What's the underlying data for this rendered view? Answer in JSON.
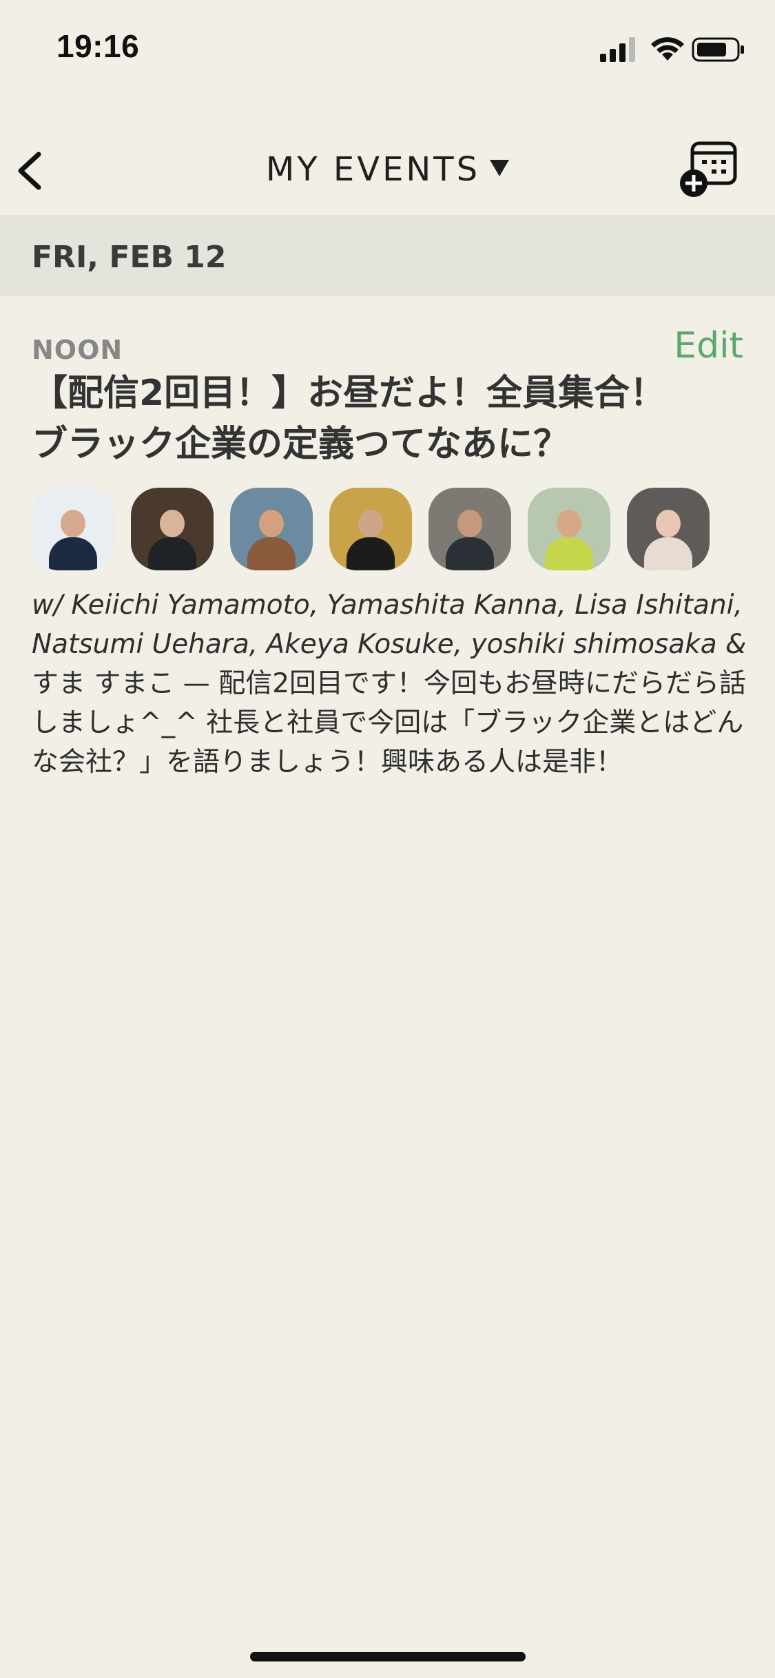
{
  "status_bar": {
    "time": "19:16",
    "icons": [
      "cellular-signal-icon",
      "wifi-icon",
      "battery-icon"
    ]
  },
  "nav": {
    "back_icon": "chevron-left-icon",
    "title": "MY EVENTS",
    "title_dropdown_icon": "caret-down-icon",
    "action_icon": "calendar-add-icon"
  },
  "date_header": {
    "label": "FRI, FEB 12"
  },
  "event": {
    "time": "NOON",
    "edit_label": "Edit",
    "title": "【配信2回目！】お昼だよ！全員集合！ブラック企業の定義つてなあに？",
    "hosts": "w/ Keiichi Yamamoto, Yamashita Kanna, Lisa Ishitani, Natsumi Uehara, Akeya Kosuke, yoshiki shimosaka &",
    "description": "すま すまこ — 配信2回目です！今回もお昼時にだらだら話しましょ^_^ 社長と社員で今回は「ブラック企業とはどんな会社？」を語りましょう！興味ある人は是非！",
    "avatars": [
      {
        "name": "Keiichi Yamamoto",
        "bg": "#e9eef3",
        "body": "#1d2a44",
        "head": "#d7a98c"
      },
      {
        "name": "Yamashita Kanna",
        "bg": "#4a3a2e",
        "body": "#1f2226",
        "head": "#d9b49a"
      },
      {
        "name": "Lisa Ishitani",
        "bg": "#6c8aa0",
        "body": "#8a5a3a",
        "head": "#d4a180"
      },
      {
        "name": "Natsumi Uehara",
        "bg": "#c9a24a",
        "body": "#1c1c1c",
        "head": "#cfa58a"
      },
      {
        "name": "Akeya Kosuke",
        "bg": "#7c7a72",
        "body": "#2b2f36",
        "head": "#c59a7c"
      },
      {
        "name": "yoshiki shimosaka",
        "bg": "#b7c7b0",
        "body": "#c6d64a",
        "head": "#d6a886"
      },
      {
        "name": "すま すまこ",
        "bg": "#5e5b58",
        "body": "#e8dcd2",
        "head": "#e9c7b2"
      }
    ]
  },
  "colors": {
    "background": "#f1efe6",
    "date_header_bg": "#e4e3dc",
    "accent_green": "#5aa86a",
    "muted_text": "#878787"
  }
}
